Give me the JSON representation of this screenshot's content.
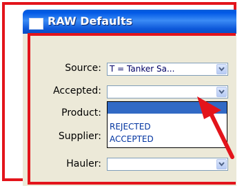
{
  "window": {
    "title": "RAW Defaults"
  },
  "fields": {
    "source": {
      "label": "Source:",
      "value": "T = Tanker Sa..."
    },
    "accepted": {
      "label": "Accepted:",
      "value": ""
    },
    "product": {
      "label": "Product:"
    },
    "supplier": {
      "label": "Supplier:"
    },
    "hauler": {
      "label": "Hauler:",
      "value": ""
    }
  },
  "accepted_dropdown": {
    "options": [
      "",
      "REJECTED",
      "ACCEPTED"
    ],
    "selected_index": 0
  },
  "colors": {
    "highlight_border": "#e3141b",
    "arrow": "#e3141b",
    "titlebar": "#0a5ed8",
    "selection": "#316ac5"
  },
  "icons": [
    "window-icon",
    "chevron-down-icon",
    "red-pointer-arrow"
  ]
}
